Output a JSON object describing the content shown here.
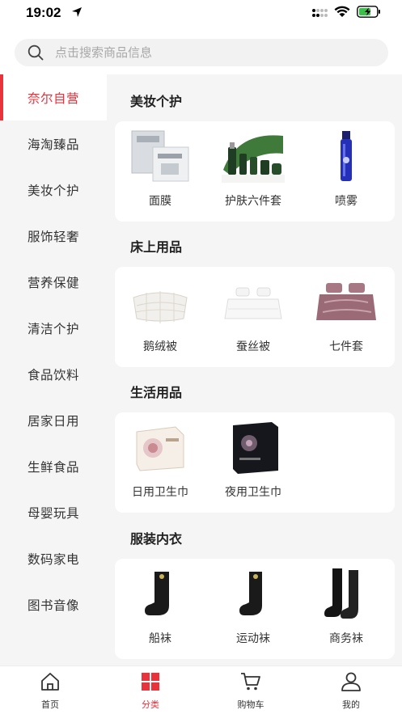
{
  "status_bar": {
    "time": "19:02"
  },
  "search": {
    "placeholder": "点击搜索商品信息"
  },
  "sidebar": {
    "items": [
      {
        "label": "奈尔自营"
      },
      {
        "label": "海淘臻品"
      },
      {
        "label": "美妆个护"
      },
      {
        "label": "服饰轻奢"
      },
      {
        "label": "营养保健"
      },
      {
        "label": "清洁个护"
      },
      {
        "label": "食品饮料"
      },
      {
        "label": "居家日用"
      },
      {
        "label": "生鲜食品"
      },
      {
        "label": "母婴玩具"
      },
      {
        "label": "数码家电"
      },
      {
        "label": "图书音像"
      }
    ]
  },
  "sections": [
    {
      "title": "美妆个护",
      "products": [
        {
          "name": "面膜"
        },
        {
          "name": "护肤六件套"
        },
        {
          "name": "喷雾"
        }
      ]
    },
    {
      "title": "床上用品",
      "products": [
        {
          "name": "鹅绒被"
        },
        {
          "name": "蚕丝被"
        },
        {
          "name": "七件套"
        }
      ]
    },
    {
      "title": "生活用品",
      "products": [
        {
          "name": "日用卫生巾"
        },
        {
          "name": "夜用卫生巾"
        }
      ]
    },
    {
      "title": "服装内衣",
      "products": [
        {
          "name": "船袜"
        },
        {
          "name": "运动袜"
        },
        {
          "name": "商务袜"
        }
      ]
    }
  ],
  "tabbar": {
    "tabs": [
      {
        "label": "首页"
      },
      {
        "label": "分类"
      },
      {
        "label": "购物车"
      },
      {
        "label": "我的"
      }
    ]
  },
  "colors": {
    "accent": "#e8323c",
    "sidebar_bg": "#f5f5f5",
    "card_bg": "#ffffff"
  }
}
